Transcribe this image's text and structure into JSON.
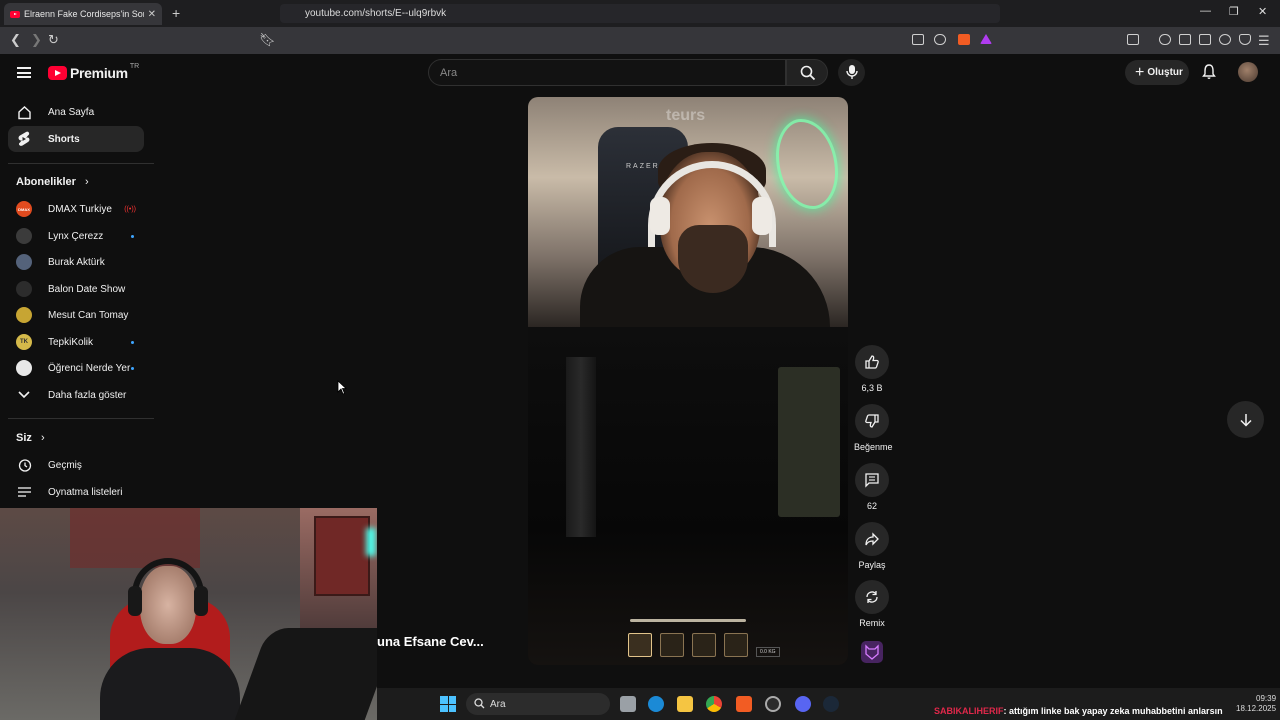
{
  "browser": {
    "tab_title": "Elraenn Fake Cordiseps'in Son",
    "url": "youtube.com/shorts/E--ulq9rbvk"
  },
  "header": {
    "logo_word": "Premium",
    "logo_country": "TR",
    "search_placeholder": "Ara",
    "create_label": "Oluştur"
  },
  "sidebar": {
    "home": "Ana Sayfa",
    "shorts": "Shorts",
    "subscriptions_heading": "Abonelikler",
    "channels": [
      {
        "name": "DMAX Turkiye",
        "avatar_text": "DMAX",
        "color": "#e04b1f"
      },
      {
        "name": "Lynx Çerezz",
        "avatar_text": "",
        "color": "#3b3b3b"
      },
      {
        "name": "Burak Aktürk",
        "avatar_text": "",
        "color": "#54627a"
      },
      {
        "name": "Balon Date Show",
        "avatar_text": "",
        "color": "#2c2c2c"
      },
      {
        "name": "Mesut Can Tomay",
        "avatar_text": "",
        "color": "#c7a533"
      },
      {
        "name": "TepkiKolik",
        "avatar_text": "TK",
        "color": "#d4b94a"
      },
      {
        "name": "Öğrenci Nerde Yer",
        "avatar_text": "",
        "color": "#e8e8e8"
      }
    ],
    "show_more": "Daha fazla göster",
    "you_heading": "Siz",
    "history": "Geçmiş",
    "playlists": "Oynatma listeleri"
  },
  "short": {
    "watermark": "teurs",
    "chair_brand": "RAZER",
    "weight_readout": "0.0 KG",
    "caption": "una Efsane Cev...",
    "likes": "6,3 B",
    "dislike_label": "Beğenme",
    "comments": "62",
    "share_label": "Paylaş",
    "remix_label": "Remix"
  },
  "taskbar": {
    "search_label": "Ara",
    "ticker_user": "SABIKALIHERIF",
    "ticker_message": ": attığım linke bak yapay zeka muhabbetini anlarsın",
    "time": "09:39",
    "date": "18.12.2025"
  }
}
